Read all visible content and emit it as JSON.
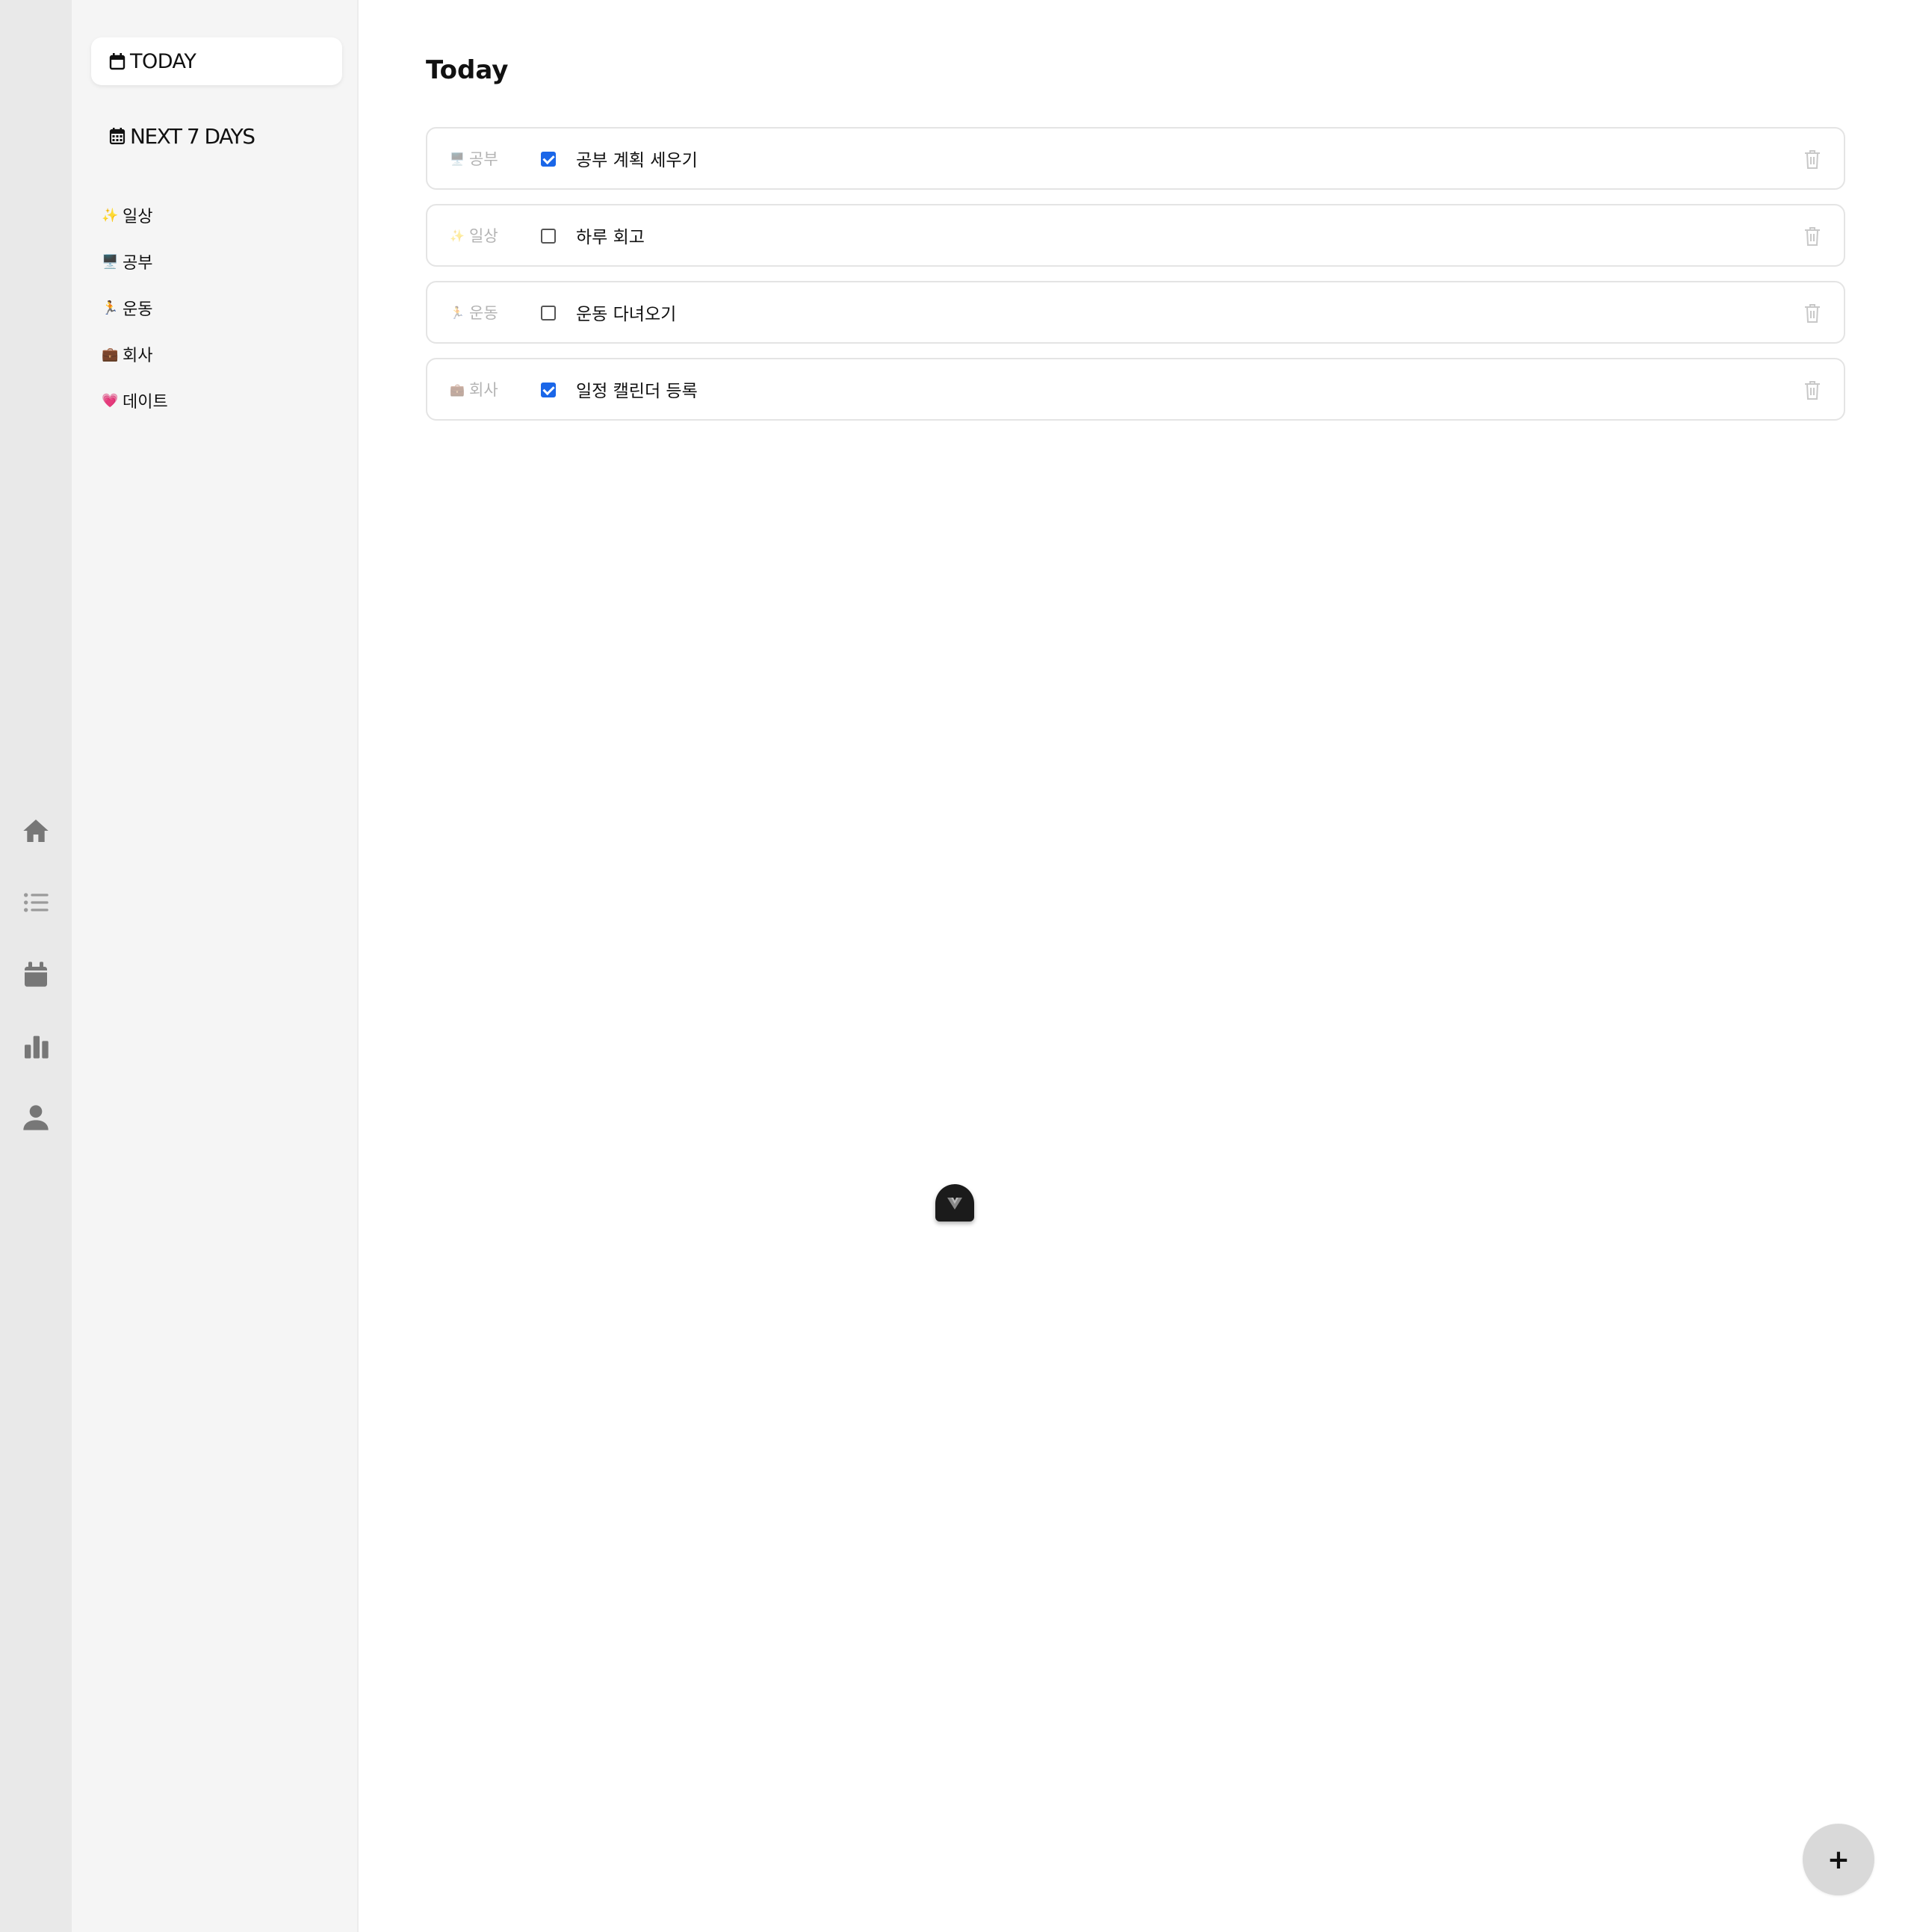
{
  "rail": {
    "icons": [
      "home-icon",
      "list-icon",
      "calendar-icon",
      "chart-icon",
      "user-icon"
    ],
    "icon_color": "#777777"
  },
  "sidebar": {
    "today_label": "TODAY",
    "next7_label": "NEXT 7 DAYS",
    "categories": [
      {
        "emoji": "✨",
        "label": "일상"
      },
      {
        "emoji": "🖥️",
        "label": "공부"
      },
      {
        "emoji": "🏃",
        "label": "운동"
      },
      {
        "emoji": "💼",
        "label": "회사"
      },
      {
        "emoji": "💗",
        "label": "데이트"
      }
    ]
  },
  "main": {
    "title": "Today",
    "todos": [
      {
        "category_emoji": "🖥️",
        "category": "공부",
        "text": "공부 계획 세우기",
        "done": true
      },
      {
        "category_emoji": "✨",
        "category": "일상",
        "text": "하루 회고",
        "done": false
      },
      {
        "category_emoji": "🏃",
        "category": "운동",
        "text": "운동 다녀오기",
        "done": false
      },
      {
        "category_emoji": "💼",
        "category": "회사",
        "text": "일정 캘린더 등록",
        "done": true
      }
    ]
  },
  "fab": {
    "label": "+"
  },
  "colors": {
    "accent_checkbox": "#1a66e8",
    "rail_bg": "#e9e9e9",
    "sidebar_bg": "#f5f5f5"
  }
}
